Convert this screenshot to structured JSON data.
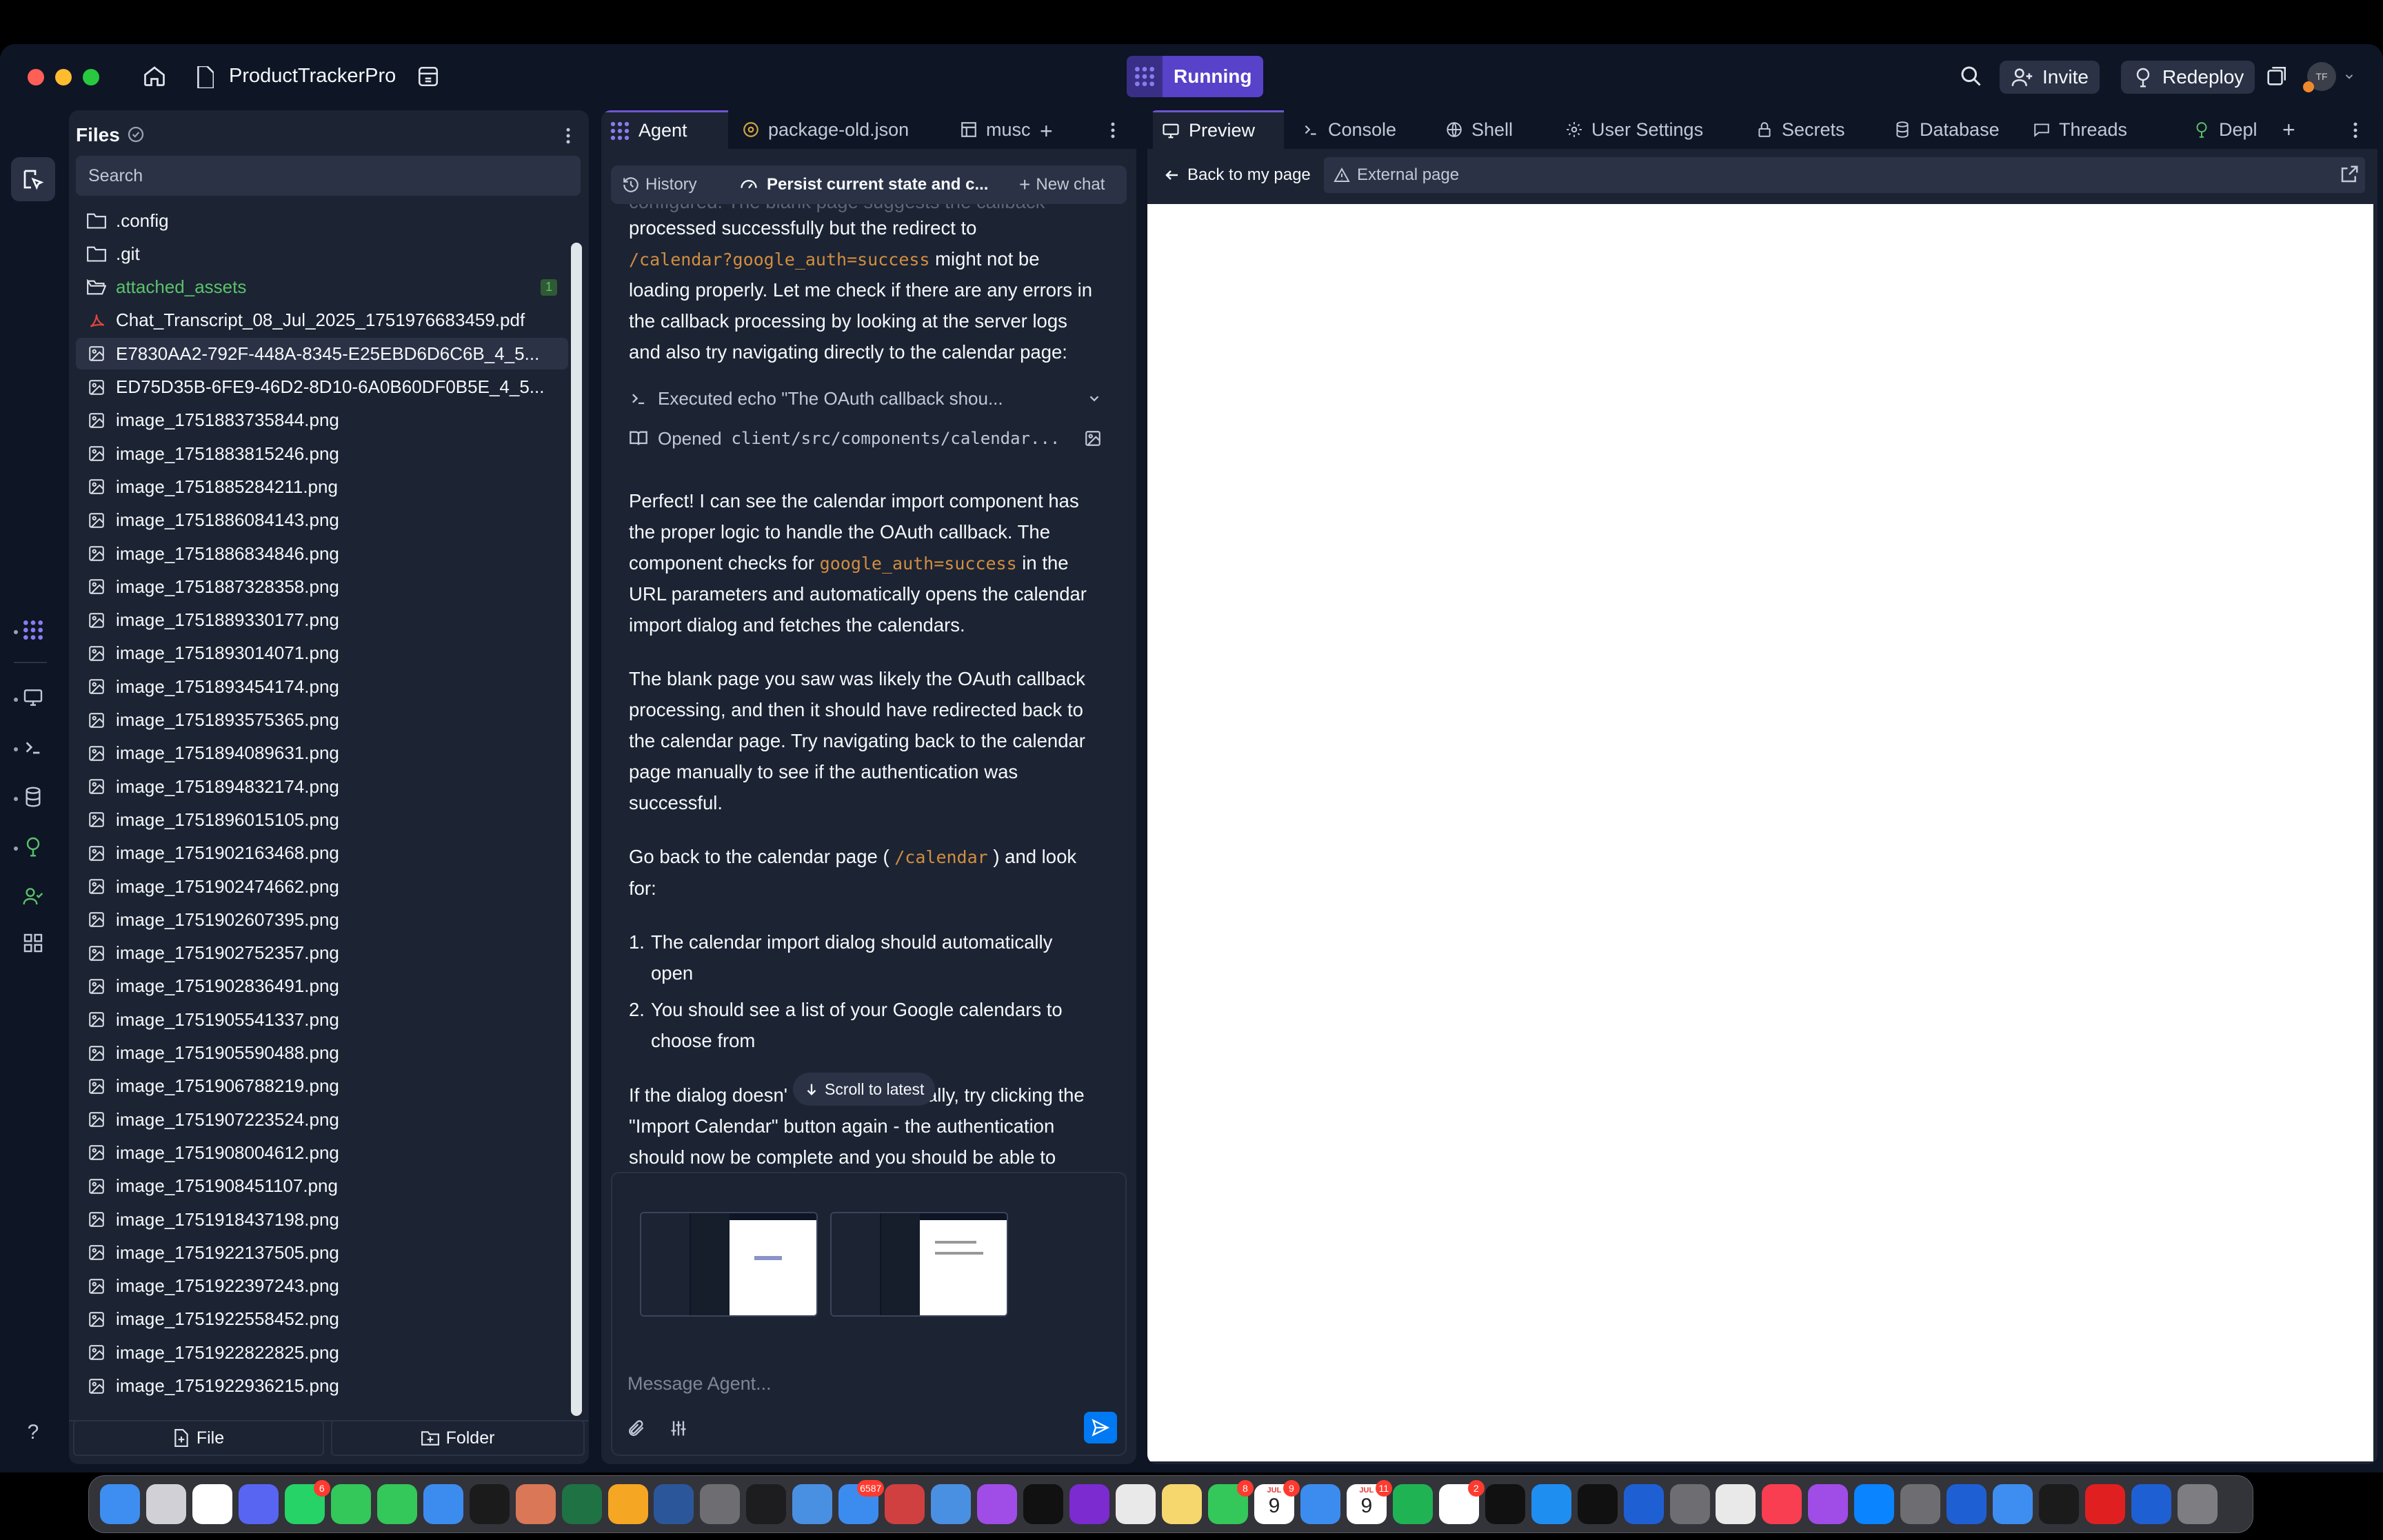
{
  "titlebar": {
    "project_name": "ProductTrackerPro",
    "status": "Running",
    "invite_label": "Invite",
    "redeploy_label": "Redeploy",
    "avatar_initials": "TF"
  },
  "files": {
    "title": "Files",
    "search_placeholder": "Search",
    "items": [
      {
        "name": ".config",
        "type": "folder"
      },
      {
        "name": ".git",
        "type": "folder"
      },
      {
        "name": "attached_assets",
        "type": "folder-open",
        "badge": "1"
      },
      {
        "name": "Chat_Transcript_08_Jul_2025_1751976683459.pdf",
        "type": "pdf"
      },
      {
        "name": "E7830AA2-792F-448A-8345-E25EBD6D6C6B_4_5...",
        "type": "image",
        "selected": true
      },
      {
        "name": "ED75D35B-6FE9-46D2-8D10-6A0B60DF0B5E_4_5...",
        "type": "image"
      },
      {
        "name": "image_1751883735844.png",
        "type": "image"
      },
      {
        "name": "image_1751883815246.png",
        "type": "image"
      },
      {
        "name": "image_1751885284211.png",
        "type": "image"
      },
      {
        "name": "image_1751886084143.png",
        "type": "image"
      },
      {
        "name": "image_1751886834846.png",
        "type": "image"
      },
      {
        "name": "image_1751887328358.png",
        "type": "image"
      },
      {
        "name": "image_1751889330177.png",
        "type": "image"
      },
      {
        "name": "image_1751893014071.png",
        "type": "image"
      },
      {
        "name": "image_1751893454174.png",
        "type": "image"
      },
      {
        "name": "image_1751893575365.png",
        "type": "image"
      },
      {
        "name": "image_1751894089631.png",
        "type": "image"
      },
      {
        "name": "image_1751894832174.png",
        "type": "image"
      },
      {
        "name": "image_1751896015105.png",
        "type": "image"
      },
      {
        "name": "image_1751902163468.png",
        "type": "image"
      },
      {
        "name": "image_1751902474662.png",
        "type": "image"
      },
      {
        "name": "image_1751902607395.png",
        "type": "image"
      },
      {
        "name": "image_1751902752357.png",
        "type": "image"
      },
      {
        "name": "image_1751902836491.png",
        "type": "image"
      },
      {
        "name": "image_1751905541337.png",
        "type": "image"
      },
      {
        "name": "image_1751905590488.png",
        "type": "image"
      },
      {
        "name": "image_1751906788219.png",
        "type": "image"
      },
      {
        "name": "image_1751907223524.png",
        "type": "image"
      },
      {
        "name": "image_1751908004612.png",
        "type": "image"
      },
      {
        "name": "image_1751908451107.png",
        "type": "image"
      },
      {
        "name": "image_1751918437198.png",
        "type": "image"
      },
      {
        "name": "image_1751922137505.png",
        "type": "image"
      },
      {
        "name": "image_1751922397243.png",
        "type": "image"
      },
      {
        "name": "image_1751922558452.png",
        "type": "image"
      },
      {
        "name": "image_1751922822825.png",
        "type": "image"
      },
      {
        "name": "image_1751922936215.png",
        "type": "image"
      }
    ],
    "new_file_label": "File",
    "new_folder_label": "Folder"
  },
  "agent": {
    "tabs": [
      {
        "label": "Agent",
        "active": true
      },
      {
        "label": "package-old.json",
        "active": false
      },
      {
        "label": "musc",
        "active": false
      }
    ],
    "history_label": "History",
    "thread_title": "Persist current state and c...",
    "new_chat_label": "New chat",
    "partial_top": "configured. The blank page suggests the callback",
    "msg1_a": "processed successfully but the redirect to",
    "msg1_code": "/calendar?google_auth=success",
    "msg1_b": "might not be",
    "msg1_c": "loading properly. Let me check if there are any errors in",
    "msg1_d": "the callback processing by looking at the server logs",
    "msg1_e": "and also try navigating directly to the calendar page:",
    "action1": "Executed echo \"The OAuth callback shou...",
    "action2_prefix": "Opened",
    "action2_path": "client/src/components/calendar...",
    "msg2_a": "Perfect! I can see the calendar import component has",
    "msg2_b": "the proper logic to handle the OAuth callback. The",
    "msg2_c1": "component checks for",
    "msg2_code": "google_auth=success",
    "msg2_c2": "in the",
    "msg2_d": "URL parameters and automatically opens the calendar",
    "msg2_e": "import dialog and fetches the calendars.",
    "msg3_a": "The blank page you saw was likely the OAuth callback",
    "msg3_b": "processing, and then it should have redirected back to",
    "msg3_c": "the calendar page. Try navigating back to the calendar",
    "msg3_d": "page manually to see if the authentication was",
    "msg3_e": "successful.",
    "msg4_a": "Go back to the calendar page (",
    "msg4_code": "/calendar",
    "msg4_b": ") and look",
    "msg4_c": "for:",
    "list1_a": "The calendar import dialog should automatically",
    "list1_b": "open",
    "list2_a": "You should see a list of your Google calendars to",
    "list2_b": "choose from",
    "msg5_a1": "If the dialog doesn'",
    "msg5_a2": "ally, try clicking the",
    "msg5_b": "\"Import Calendar\" button again - the authentication",
    "msg5_c": "should now be complete and you should be able to",
    "scroll_latest": "Scroll to latest",
    "input_placeholder": "Message Agent..."
  },
  "preview": {
    "tabs": [
      "Preview",
      "Console",
      "Shell",
      "User Settings",
      "Secrets",
      "Database",
      "Threads",
      "Depl"
    ],
    "back_label": "Back to my page",
    "external_label": "External page"
  },
  "dock": {
    "badges": [
      "6",
      "6587",
      "8",
      "9",
      "11",
      "2"
    ],
    "calendar_day": "9",
    "calendar_month": "JUL"
  },
  "colors": {
    "accent": "#6e56cf",
    "running_bg": "#5742c9",
    "background": "#0e1525",
    "panel": "#1c2333",
    "code": "#d28e3f"
  }
}
